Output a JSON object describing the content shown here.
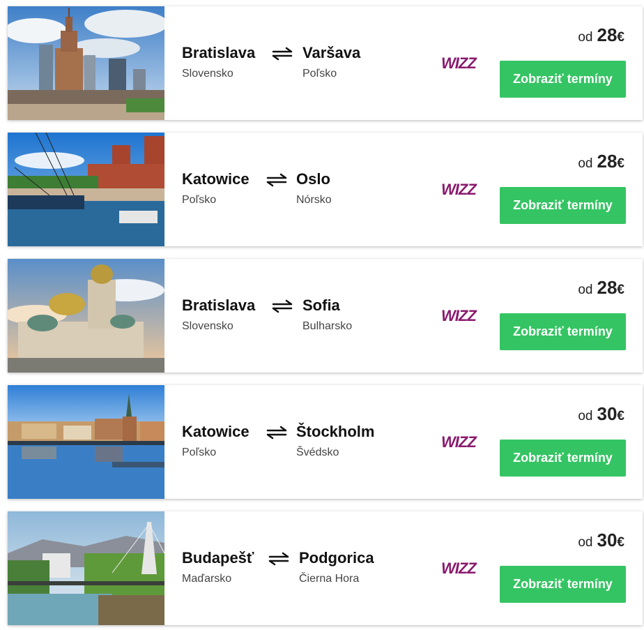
{
  "ui": {
    "price_prefix": "od",
    "currency": "€",
    "button_label": "Zobraziť termíny",
    "airline_logo_text": "WIZZ",
    "colors": {
      "button": "#35c463",
      "logo_primary": "#8a1a6e",
      "logo_accent": "#c6007e"
    },
    "icons": {
      "route": "bidirectional-arrow-icon"
    }
  },
  "routes": [
    {
      "from": "Bratislava",
      "from_country": "Slovensko",
      "to": "Varšava",
      "to_country": "Poľsko",
      "price": "28",
      "image": "warsaw-palace-of-culture-photo"
    },
    {
      "from": "Katowice",
      "from_country": "Poľsko",
      "to": "Oslo",
      "to_country": "Nórsko",
      "price": "28",
      "image": "oslo-harbour-photo"
    },
    {
      "from": "Bratislava",
      "from_country": "Slovensko",
      "to": "Sofia",
      "to_country": "Bulharsko",
      "price": "28",
      "image": "sofia-cathedral-photo"
    },
    {
      "from": "Katowice",
      "from_country": "Poľsko",
      "to": "Štockholm",
      "to_country": "Švédsko",
      "price": "30",
      "image": "stockholm-waterfront-photo"
    },
    {
      "from": "Budapešť",
      "from_country": "Maďarsko",
      "to": "Podgorica",
      "to_country": "Čierna Hora",
      "price": "30",
      "image": "podgorica-bridge-photo"
    }
  ]
}
